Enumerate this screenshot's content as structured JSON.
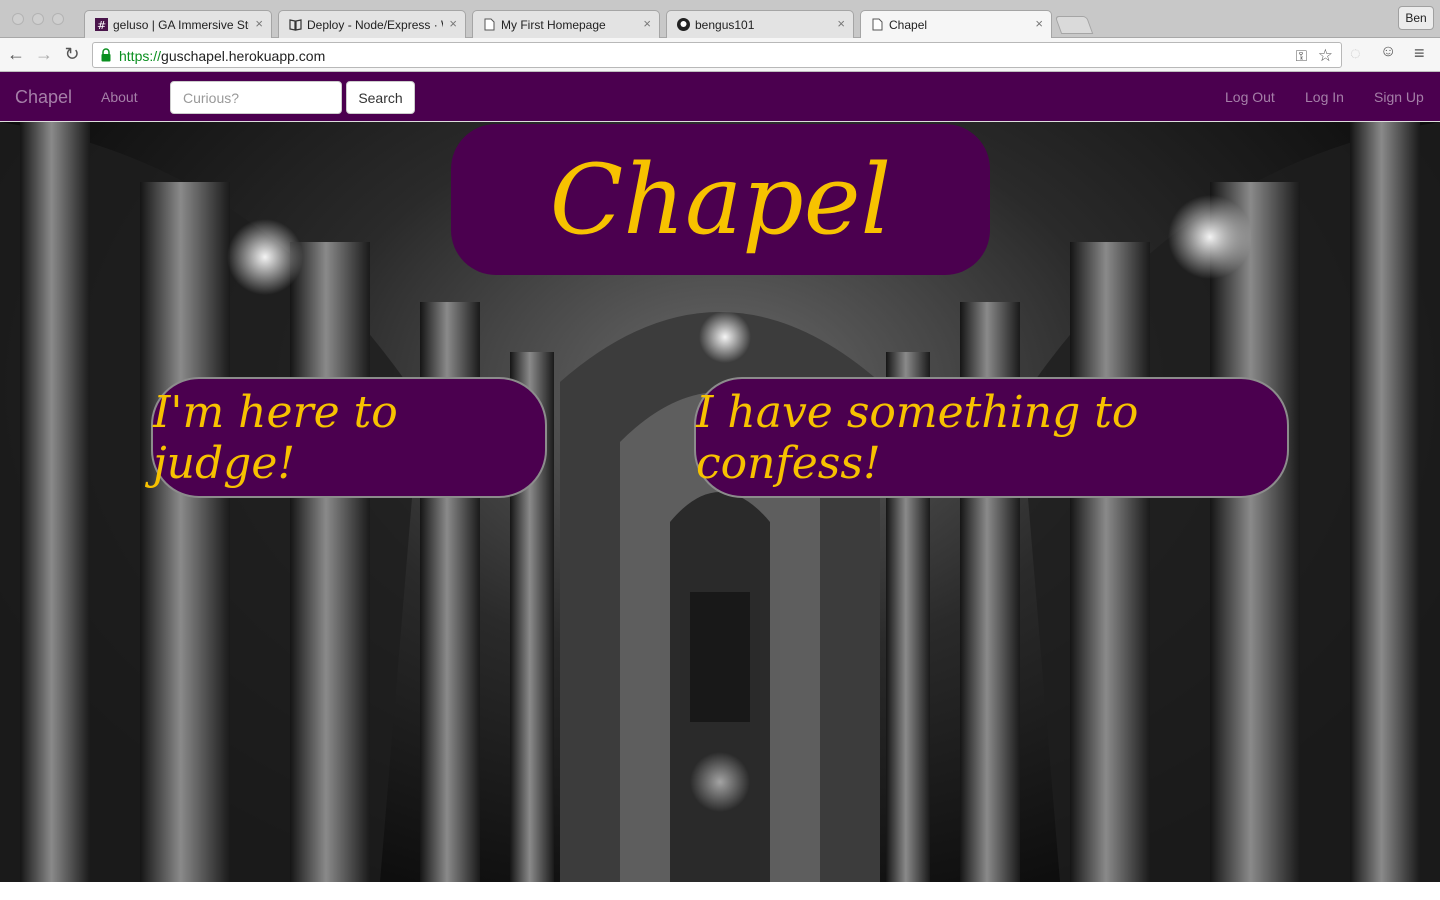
{
  "browser": {
    "profile_label": "Ben",
    "tabs": [
      {
        "title": "geluso | GA Immersive Stuc",
        "icon": "slack-icon",
        "active": false
      },
      {
        "title": "Deploy - Node/Express · W",
        "icon": "book-icon",
        "active": false
      },
      {
        "title": "My First Homepage",
        "icon": "page-icon",
        "active": false
      },
      {
        "title": "bengus101",
        "icon": "github-icon",
        "active": false
      },
      {
        "title": "Chapel",
        "icon": "page-icon",
        "active": true
      }
    ],
    "url_scheme": "https://",
    "url_host": "guschapel.herokuapp.com"
  },
  "nav": {
    "brand": "Chapel",
    "about": "About",
    "search_placeholder": "Curious?",
    "search_button": "Search",
    "logout": "Log Out",
    "login": "Log In",
    "signup": "Sign Up"
  },
  "hero": {
    "logo_text": "Chapel",
    "judge_button": "I'm here to judge!",
    "confess_button": "I have something to confess!"
  },
  "colors": {
    "brand_purple": "#4b004f",
    "accent_gold": "#f7c200",
    "nav_link": "#a57fa8"
  }
}
